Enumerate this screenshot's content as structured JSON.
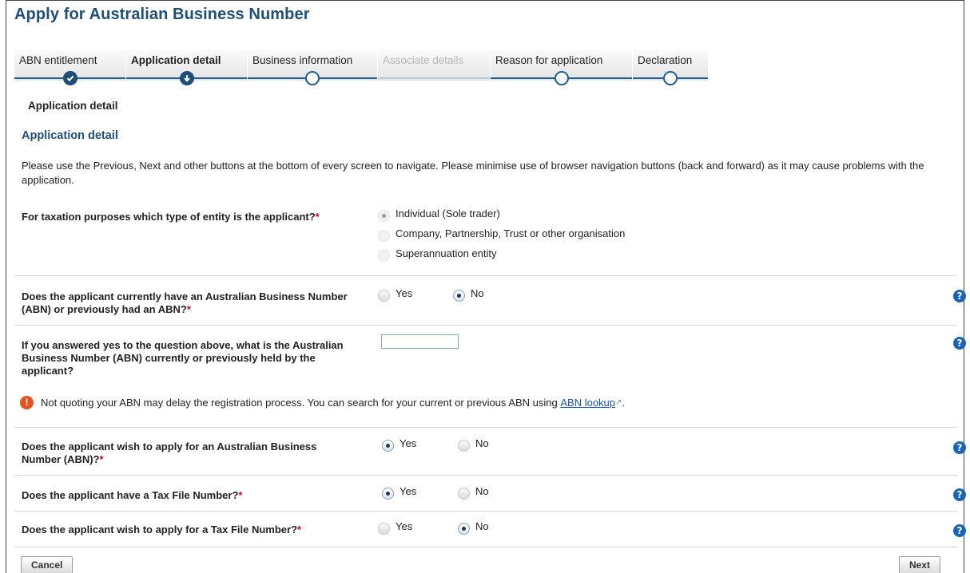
{
  "page": {
    "title": "Apply for Australian Business Number"
  },
  "steps": [
    {
      "label": "ABN entitlement",
      "state": "done"
    },
    {
      "label": "Application detail",
      "state": "current"
    },
    {
      "label": "Business information",
      "state": "todo"
    },
    {
      "label": "Associate details",
      "state": "disabled"
    },
    {
      "label": "Reason for application",
      "state": "todo"
    },
    {
      "label": "Declaration",
      "state": "todo"
    }
  ],
  "breadcrumb": "Application detail",
  "section_title": "Application detail",
  "intro": "Please use the Previous, Next and other buttons at the bottom of every screen to navigate. Please minimise use of browser navigation buttons (back and forward) as it may cause problems with the application.",
  "questions": {
    "entity_type": {
      "label": "For taxation purposes which type of entity is the applicant?",
      "required_mark": "*",
      "options": [
        "Individual (Sole trader)",
        "Company, Partnership, Trust or other organisation",
        "Superannuation entity"
      ],
      "selected": "Individual (Sole trader)"
    },
    "has_abn": {
      "label": "Does the applicant currently have an Australian Business Number (ABN) or previously had an ABN?",
      "required_mark": "*",
      "yes": "Yes",
      "no": "No",
      "selected": "No"
    },
    "abn_number": {
      "label": "If you answered yes to the question above, what is the Australian Business Number (ABN) currently or previously held by the applicant?",
      "value": ""
    },
    "apply_abn": {
      "label": "Does the applicant wish to apply for an Australian Business Number (ABN)?",
      "required_mark": "*",
      "yes": "Yes",
      "no": "No",
      "selected": "Yes"
    },
    "has_tfn": {
      "label": "Does the applicant have a Tax File Number?",
      "required_mark": "*",
      "yes": "Yes",
      "no": "No",
      "selected": "Yes"
    },
    "apply_tfn": {
      "label": "Does the applicant wish to apply for a Tax File Number?",
      "required_mark": "*",
      "yes": "Yes",
      "no": "No",
      "selected": "No"
    }
  },
  "warning": {
    "text": "Not quoting your ABN may delay the registration process. You can search for your current or previous ABN using",
    "link": "ABN lookup",
    "end": "."
  },
  "help_glyph": "?",
  "buttons": {
    "cancel": "Cancel",
    "next": "Next"
  },
  "colors": {
    "heading": "#1f4e79",
    "required": "#d0021b",
    "help": "#1864b8",
    "warning": "#e2531e",
    "link": "#1655b0"
  }
}
